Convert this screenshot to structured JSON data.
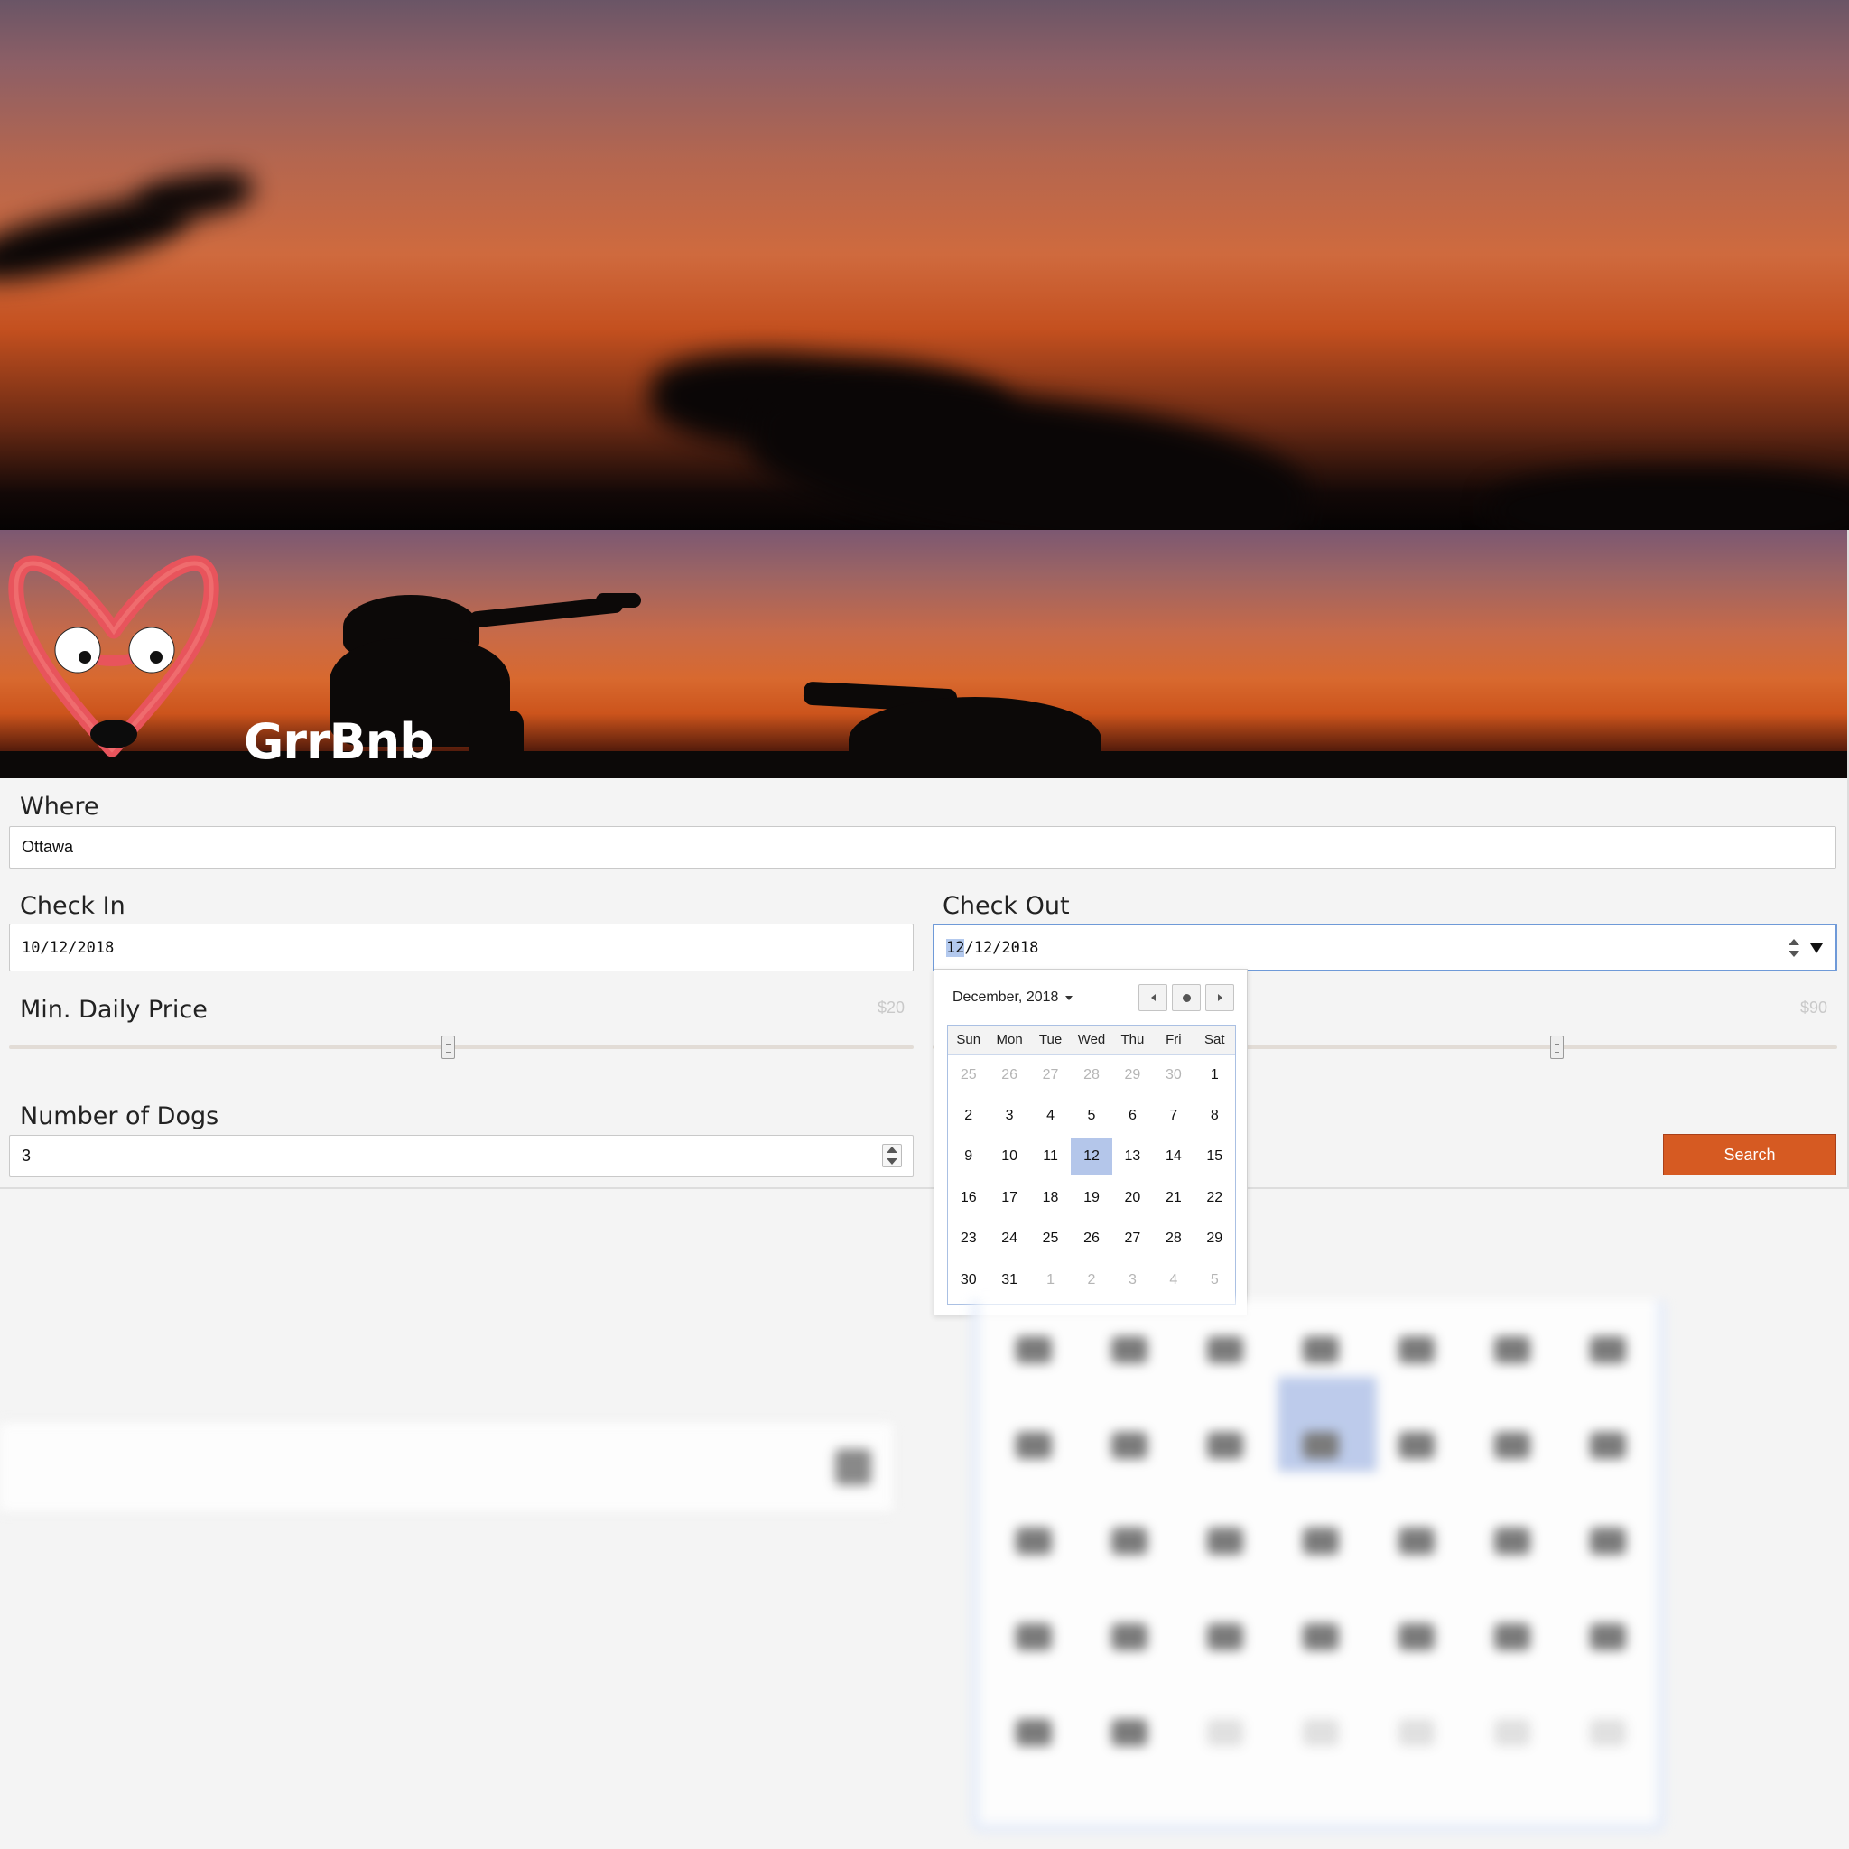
{
  "brand": {
    "name": "GrrBnb"
  },
  "form": {
    "where": {
      "label": "Where",
      "value": "Ottawa"
    },
    "check_in": {
      "label": "Check In",
      "value": "10/12/2018"
    },
    "check_out": {
      "label": "Check Out",
      "month_segment": "12",
      "rest": "/12/2018"
    },
    "min_price": {
      "label": "Min. Daily Price",
      "value": "$20",
      "slider_fraction": 0.485
    },
    "max_price": {
      "value": "$90",
      "slider_fraction": 0.69
    },
    "dogs": {
      "label": "Number of Dogs",
      "value": "3"
    },
    "search_button": "Search"
  },
  "calendar": {
    "month_label": "December, 2018",
    "weekdays": [
      "Sun",
      "Mon",
      "Tue",
      "Wed",
      "Thu",
      "Fri",
      "Sat"
    ],
    "days": [
      {
        "d": "25",
        "other": true
      },
      {
        "d": "26",
        "other": true
      },
      {
        "d": "27",
        "other": true
      },
      {
        "d": "28",
        "other": true
      },
      {
        "d": "29",
        "other": true
      },
      {
        "d": "30",
        "other": true
      },
      {
        "d": "1"
      },
      {
        "d": "2"
      },
      {
        "d": "3"
      },
      {
        "d": "4"
      },
      {
        "d": "5"
      },
      {
        "d": "6"
      },
      {
        "d": "7"
      },
      {
        "d": "8"
      },
      {
        "d": "9"
      },
      {
        "d": "10"
      },
      {
        "d": "11"
      },
      {
        "d": "12",
        "selected": true
      },
      {
        "d": "13"
      },
      {
        "d": "14"
      },
      {
        "d": "15"
      },
      {
        "d": "16"
      },
      {
        "d": "17"
      },
      {
        "d": "18"
      },
      {
        "d": "19"
      },
      {
        "d": "20"
      },
      {
        "d": "21"
      },
      {
        "d": "22"
      },
      {
        "d": "23"
      },
      {
        "d": "24"
      },
      {
        "d": "25"
      },
      {
        "d": "26"
      },
      {
        "d": "27"
      },
      {
        "d": "28"
      },
      {
        "d": "29"
      },
      {
        "d": "30"
      },
      {
        "d": "31"
      },
      {
        "d": "1",
        "other": true
      },
      {
        "d": "2",
        "other": true
      },
      {
        "d": "3",
        "other": true
      },
      {
        "d": "4",
        "other": true
      },
      {
        "d": "5",
        "other": true
      }
    ]
  },
  "colors": {
    "accent": "#d65a22",
    "logo": "#e8545c",
    "selected_day": "#b4c6ea",
    "focus": "#6f9ad8"
  },
  "icons": [
    "logo-icon",
    "chevron-left-icon",
    "today-dot-icon",
    "chevron-right-icon",
    "dropdown-arrow-icon",
    "stepper-icon"
  ]
}
